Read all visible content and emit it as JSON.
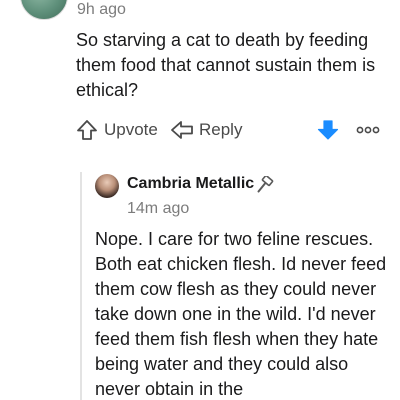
{
  "parent_comment": {
    "timestamp": "9h ago",
    "body": "So starving a cat to death by feeding them food that cannot sustain them is ethical?",
    "actions": {
      "upvote_label": "Upvote",
      "reply_label": "Reply"
    }
  },
  "reply_comment": {
    "username": "Cambria Metallic",
    "timestamp": "14m ago",
    "body": "Nope. I care for two feline rescues. Both eat chicken flesh. Id never feed them cow flesh as they could never take down one in the wild. I'd never feed them fish flesh when they hate being water and they could also never obtain in the"
  },
  "colors": {
    "downvote_active": "#1a8cff",
    "muted_text": "#7c7c7c",
    "thread_line": "#e3e3e3"
  },
  "icons": {
    "upvote": "upvote-arrow-icon",
    "reply": "reply-arrow-icon",
    "downvote": "downvote-arrow-icon",
    "more": "more-options-icon",
    "mod": "hammer-icon"
  }
}
